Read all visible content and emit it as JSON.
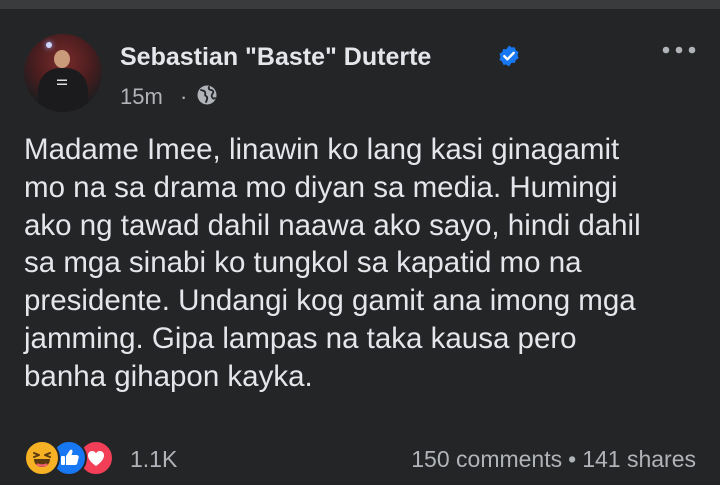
{
  "post": {
    "author": "Sebastian \"Baste\" Duterte",
    "timestamp": "15m",
    "separator": "·",
    "visibility_icon": "globe-icon",
    "verified_icon": "verified-badge-icon",
    "more_icon": "more-options-icon",
    "body_lines": [
      "Madame Imee, linawin ko lang kasi ginagamit",
      "mo na sa drama mo diyan sa media. Humingi",
      "ako ng tawad dahil naawa ako sayo, hindi dahil",
      "sa mga sinabi ko tungkol sa kapatid mo na",
      "presidente. Undangi kog gamit ana imong mga",
      "jamming. Gipa lampas na taka kausa pero",
      "banha gihapon kayka."
    ],
    "reactions": {
      "icons": [
        "haha-icon",
        "like-icon",
        "love-icon"
      ],
      "count": "1.1K"
    },
    "stats": {
      "comments": "150 comments",
      "separator": "•",
      "shares": "141 shares"
    }
  },
  "colors": {
    "background": "#242526",
    "text": "#e4e6eb",
    "secondary_text": "#b0b3b8",
    "verified": "#1877f2",
    "like": "#1877f2",
    "love": "#f33e58",
    "haha": "#f7b125"
  }
}
